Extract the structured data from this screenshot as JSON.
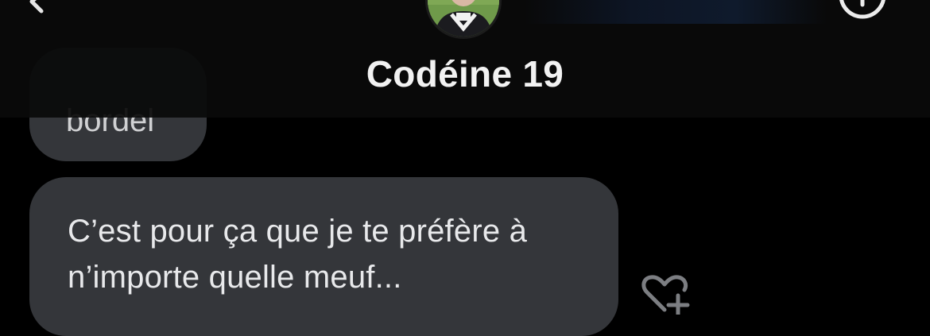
{
  "header": {
    "title": "Codéine 19",
    "back_icon": "chevron-left-icon",
    "info_icon": "info-circle-icon"
  },
  "messages": [
    {
      "partial_text": "bordel"
    },
    {
      "lines": [
        "C’est pour ça que je te préfère à",
        "n’importe quelle meuf..."
      ]
    }
  ],
  "reaction_icon": "heart-plus-icon",
  "colors": {
    "background": "#000000",
    "bubble": "#34363a",
    "text": "#e8e9eb"
  }
}
